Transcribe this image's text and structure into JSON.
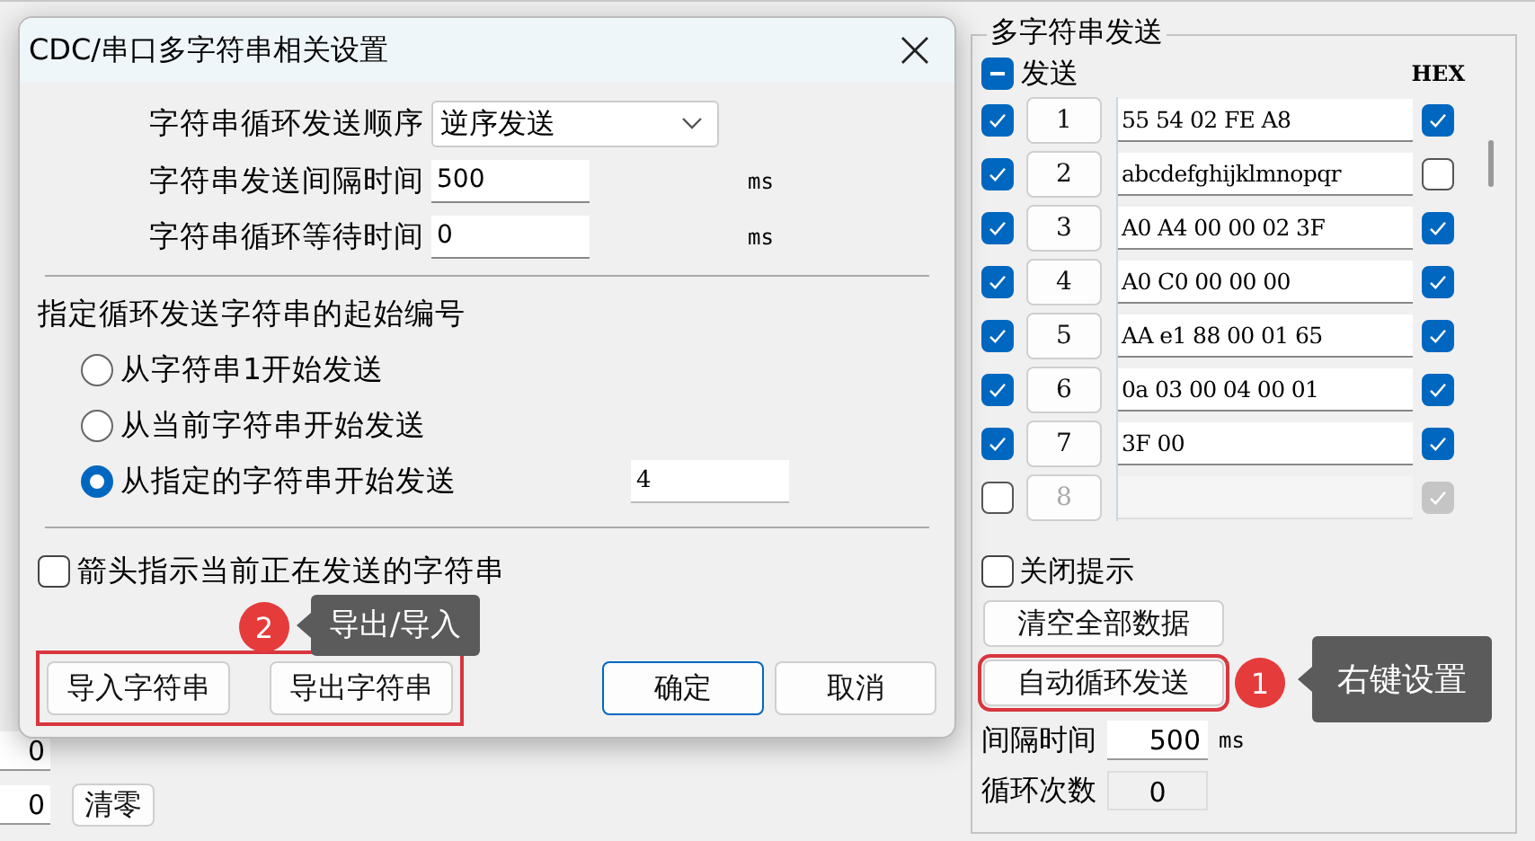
{
  "main": {
    "left_fields": [
      {
        "value": "0"
      },
      {
        "value": "0"
      }
    ],
    "clear_button": "清零",
    "multi_send": {
      "title": "多字符串发送",
      "send_all": {
        "label": "发送",
        "partial": true
      },
      "hex_header": "HEX",
      "rows": [
        {
          "send": true,
          "number": "1",
          "text": "55 54 02 FE A8",
          "hex": true,
          "disabled": false
        },
        {
          "send": true,
          "number": "2",
          "text": "abcdefghijklmnopqr",
          "hex": false,
          "disabled": false
        },
        {
          "send": true,
          "number": "3",
          "text": "A0 A4 00 00 02 3F",
          "hex": true,
          "disabled": false
        },
        {
          "send": true,
          "number": "4",
          "text": "A0 C0 00 00 00",
          "hex": true,
          "disabled": false
        },
        {
          "send": true,
          "number": "5",
          "text": "AA e1 88 00 01 65",
          "hex": true,
          "disabled": false
        },
        {
          "send": true,
          "number": "6",
          "text": "0a 03 00 04 00 01",
          "hex": true,
          "disabled": false
        },
        {
          "send": true,
          "number": "7",
          "text": "3F 00",
          "hex": true,
          "disabled": false
        },
        {
          "send": false,
          "number": "8",
          "hex": true,
          "disabled": true
        }
      ],
      "hide_tips": {
        "label": "关闭提示",
        "checked": false
      },
      "clear_all": "清空全部数据",
      "auto_loop": {
        "label": "自动循环发送",
        "highlighted": true
      },
      "callout": {
        "number": "1",
        "text": "右键设置"
      },
      "interval": {
        "label": "间隔时间",
        "value": "500",
        "unit": "ms"
      },
      "loop_count": {
        "label": "循环次数",
        "value": "0"
      }
    }
  },
  "dialog": {
    "title": "CDC/串口多字符串相关设置",
    "settings": [
      {
        "kind": "select",
        "label": "字符串循环发送顺序",
        "value": "逆序发送"
      },
      {
        "kind": "input",
        "label": "字符串发送间隔时间",
        "value": "500",
        "unit": "ms"
      },
      {
        "kind": "input",
        "label": "字符串循环等待时间",
        "value": "0",
        "unit": "ms"
      }
    ],
    "start": {
      "heading": "指定循环发送字符串的起始编号",
      "options": [
        {
          "label": "从字符串1开始发送",
          "selected": false
        },
        {
          "label": "从当前字符串开始发送",
          "selected": false
        },
        {
          "label": "从指定的字符串开始发送",
          "selected": true,
          "value": "4"
        }
      ]
    },
    "arrow_indicator": {
      "label": "箭头指示当前正在发送的字符串",
      "checked": false
    },
    "file_buttons": {
      "highlighted": true,
      "items": [
        "导入字符串",
        "导出字符串"
      ]
    },
    "confirm_buttons": [
      {
        "label": "确定",
        "default": true
      },
      {
        "label": "取消",
        "default": false
      }
    ],
    "callout": {
      "number": "2",
      "text": "导出/导入"
    }
  }
}
